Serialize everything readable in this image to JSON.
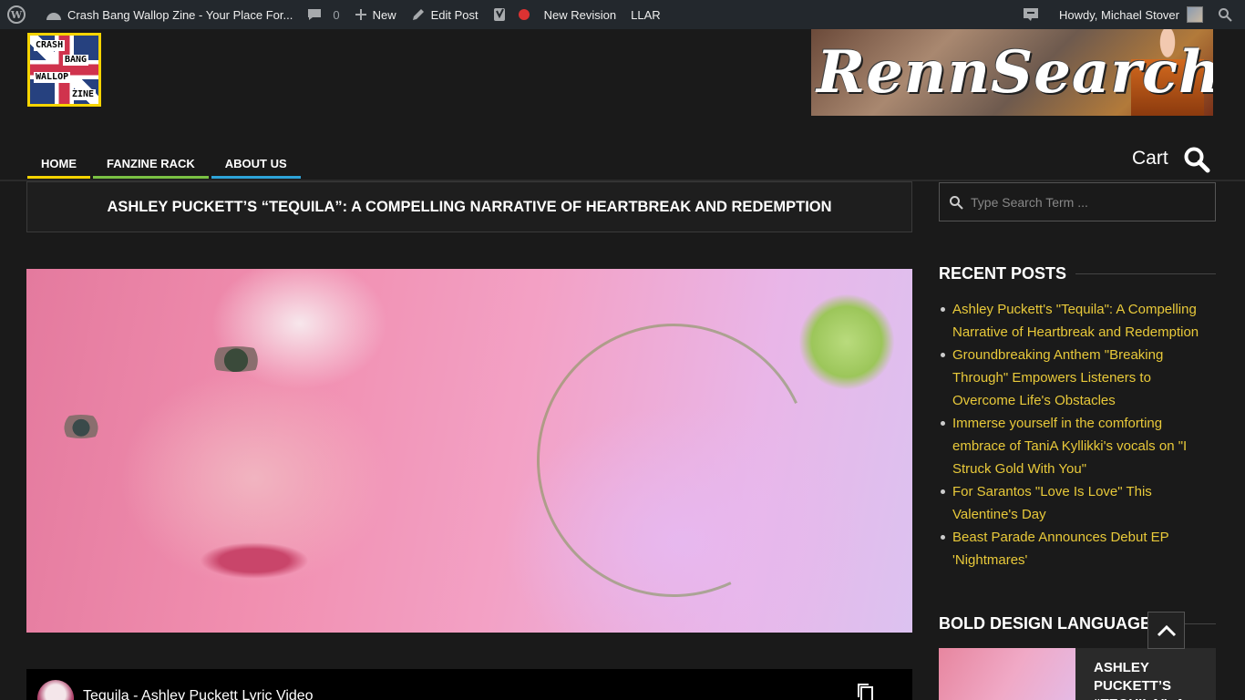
{
  "adminbar": {
    "site_name": "Crash Bang Wallop Zine - Your Place For...",
    "comments_count": "0",
    "new_label": "New",
    "edit_label": "Edit Post",
    "revision_label": "New Revision",
    "llar_label": "LLAR",
    "howdy": "Howdy, Michael Stover"
  },
  "header": {
    "logo_words": [
      "CRASH",
      "BANG",
      "WALLOP",
      "ZINE"
    ],
    "banner_text": "RennSearch"
  },
  "nav": {
    "items": [
      "HOME",
      "FANZINE RACK",
      "ABOUT US"
    ],
    "cart": "Cart"
  },
  "post": {
    "title": "ASHLEY PUCKETT’S “TEQUILA”: A COMPELLING NARRATIVE OF HEARTBREAK AND REDEMPTION",
    "video_title": "Tequila - Ashley Puckett Lyric Video"
  },
  "sidebar": {
    "search_placeholder": "Type Search Term ...",
    "recent_title": "RECENT POSTS",
    "recent_posts": [
      "Ashley Puckett's \"Tequila\": A Compelling Narrative of Heartbreak and Redemption",
      "Groundbreaking Anthem \"Breaking Through\" Empowers Listeners to Overcome Life's Obstacles",
      "Immerse yourself in the comforting embrace of TaniA Kyllikki's vocals on \"I Struck Gold With You\"",
      "For Sarantos \"Love Is Love\" This Valentine's Day",
      "Beast Parade Announces Debut EP 'Nightmares'"
    ],
    "bold_title": "BOLD DESIGN LANGUAGE",
    "featured_title": "ASHLEY PUCKETT’S “TEQUILA”: A"
  },
  "colors": {
    "link": "#e8c93a",
    "home_underline": "#f5d400",
    "fanzine_underline": "#7ac143",
    "about_underline": "#2ea3d8"
  }
}
